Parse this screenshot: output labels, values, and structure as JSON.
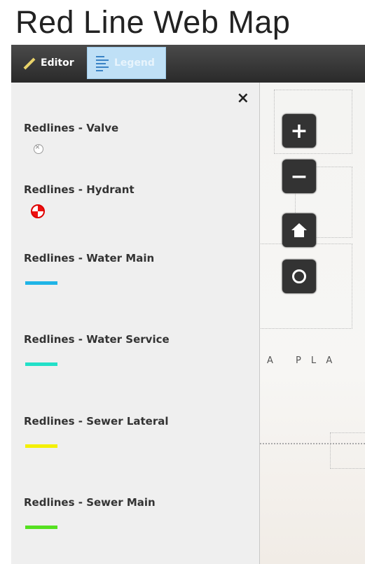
{
  "app": {
    "title": "Red Line Web Map"
  },
  "toolbar": {
    "editor_label": "Editor",
    "legend_label": "Legend"
  },
  "panel": {
    "close_glyph": "×",
    "items": [
      {
        "label": "Redlines - Valve",
        "symbol": "valve",
        "color": "#9a9a9a"
      },
      {
        "label": "Redlines - Hydrant",
        "symbol": "hydrant",
        "color": "#e01818"
      },
      {
        "label": "Redlines - Water Main",
        "symbol": "line",
        "color": "#1fb4e6"
      },
      {
        "label": "Redlines - Water Service",
        "symbol": "line",
        "color": "#22e0c8"
      },
      {
        "label": "Redlines - Sewer Lateral",
        "symbol": "line",
        "color": "#f4f000"
      },
      {
        "label": "Redlines - Sewer Main",
        "symbol": "line",
        "color": "#55e020"
      }
    ]
  },
  "map": {
    "zoom_in_glyph": "+",
    "zoom_out_glyph": "−",
    "map_text": "A PLA"
  }
}
